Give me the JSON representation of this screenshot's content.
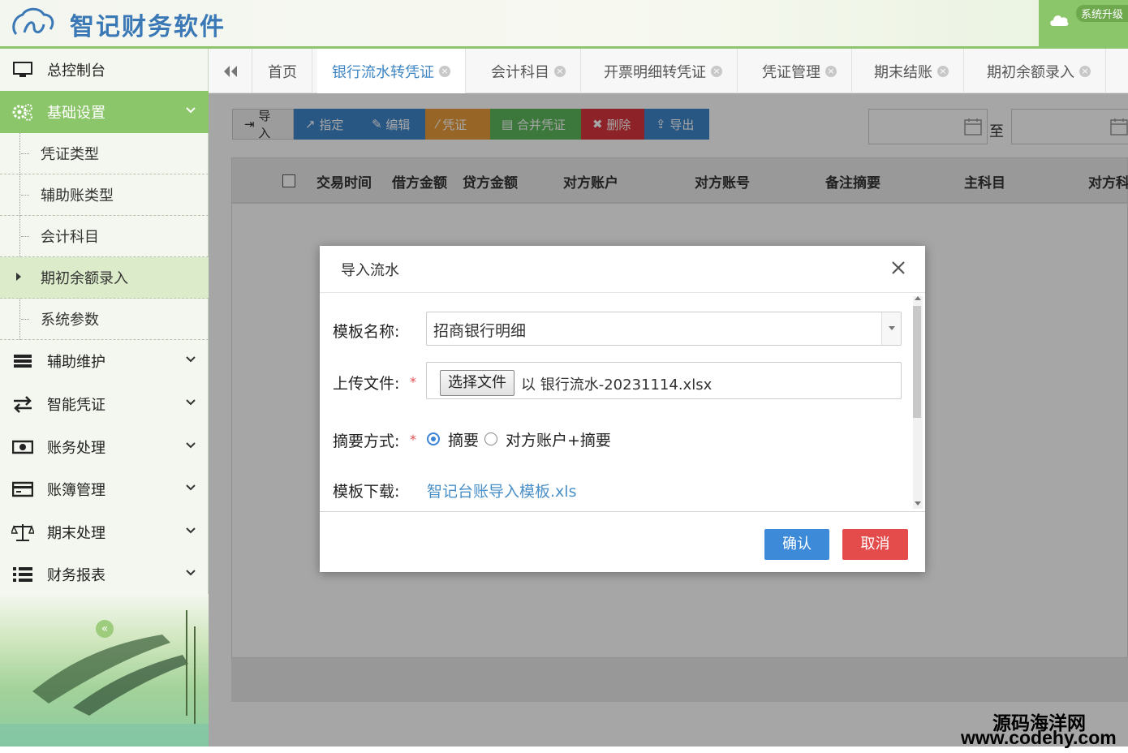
{
  "header": {
    "app_title": "智记财务软件",
    "upgrade_label": "系统升级"
  },
  "sidebar": {
    "items": [
      {
        "label": "总控制台",
        "icon": "monitor-icon"
      },
      {
        "label": "基础设置",
        "icon": "gears-icon",
        "expanded": true
      },
      {
        "label": "辅助维护",
        "icon": "list-icon"
      },
      {
        "label": "智能凭证",
        "icon": "exchange-icon"
      },
      {
        "label": "账务处理",
        "icon": "money-icon"
      },
      {
        "label": "账簿管理",
        "icon": "card-icon"
      },
      {
        "label": "期末处理",
        "icon": "scale-icon"
      },
      {
        "label": "财务报表",
        "icon": "report-icon"
      }
    ],
    "sub_items": [
      "凭证类型",
      "辅助账类型",
      "会计科目",
      "期初余额录入",
      "系统参数"
    ],
    "collapse_symbol": "«"
  },
  "tabs": [
    {
      "label": "首页"
    },
    {
      "label": "银行流水转凭证",
      "active": true
    },
    {
      "label": "会计科目"
    },
    {
      "label": "开票明细转凭证"
    },
    {
      "label": "凭证管理"
    },
    {
      "label": "期末结账"
    },
    {
      "label": "期初余额录入"
    }
  ],
  "toolbar": {
    "buttons": [
      {
        "label": "导入",
        "icon": "import-icon",
        "color": "#f0f0f0"
      },
      {
        "label": "指定",
        "icon": "share-icon",
        "color": "#3e86c9"
      },
      {
        "label": "编辑",
        "icon": "edit-icon",
        "color": "#3e86c9"
      },
      {
        "label": "凭证",
        "icon": "magic-icon",
        "color": "#e99d3d"
      },
      {
        "label": "合并凭证",
        "icon": "merge-icon",
        "color": "#5cb85c"
      },
      {
        "label": "删除",
        "icon": "delete-icon",
        "color": "#d9363e"
      },
      {
        "label": "导出",
        "icon": "export-icon",
        "color": "#3e86c9"
      }
    ],
    "date_separator": "至"
  },
  "grid": {
    "columns": [
      "交易时间",
      "借方金额",
      "贷方金额",
      "对方账户",
      "对方账号",
      "备注摘要",
      "主科目",
      "对方科"
    ]
  },
  "dialog": {
    "title": "导入流水",
    "template_label": "模板名称:",
    "template_value": "招商银行明细",
    "upload_label": "上传文件:",
    "choose_file": "选择文件",
    "file_name": "以  银行流水-20231114.xlsx",
    "summary_label": "摘要方式:",
    "options": [
      "摘要",
      "对方账户+摘要"
    ],
    "selected_option": "摘要",
    "download_label": "模板下载:",
    "download_link": "智记台账导入模板.xls",
    "required_mark": "*",
    "ok": "确认",
    "cancel": "取消"
  },
  "watermark": {
    "line1": "源码海洋网",
    "line2": "www.codehy.com"
  },
  "colors": {
    "accent_green": "#8cc66a",
    "primary_blue": "#3d8ad8",
    "danger_red": "#e44c4c"
  }
}
